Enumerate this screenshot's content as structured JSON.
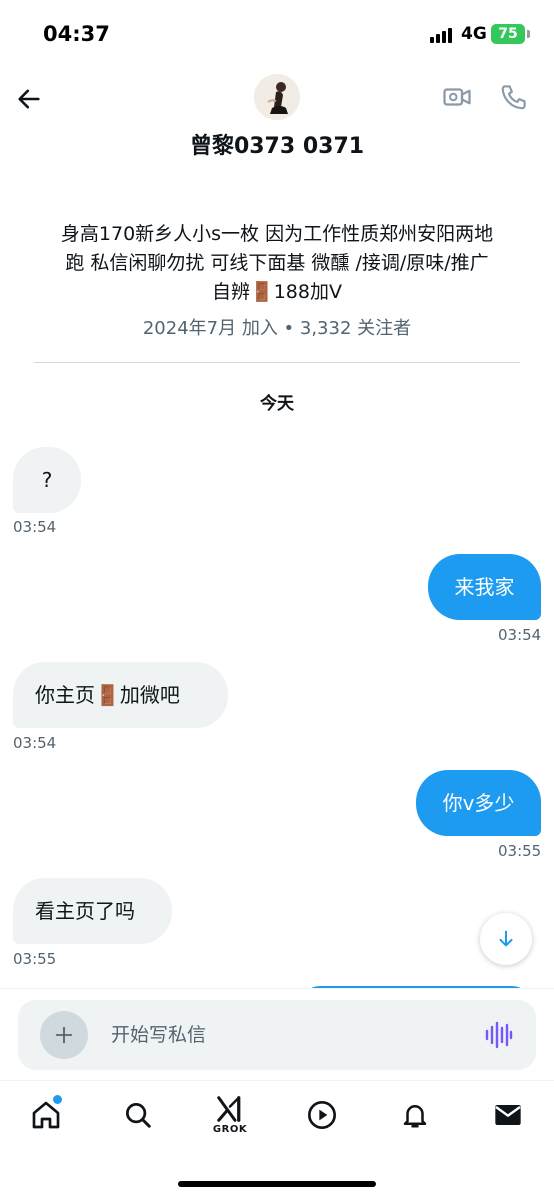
{
  "status_bar": {
    "time": "04:37",
    "network": "4G",
    "battery": "75"
  },
  "header": {
    "contact_name": "曾黎0373 0371"
  },
  "profile": {
    "bio_line1": "身高170新乡人小s一枚 因为工作性质郑州安阳两地",
    "bio_line2": "跑 私信闲聊勿扰 可线下面基 微醺 /接调/原味/推广",
    "bio_line3_prefix": "自辨",
    "bio_line3_emoji": "🚪",
    "bio_line3_suffix": "188加V",
    "joined": "2024年7月 加入 • 3,332 关注者"
  },
  "conversation": {
    "day_label": "今天",
    "messages": [
      {
        "direction": "in",
        "text": "?",
        "time": "03:54"
      },
      {
        "direction": "out",
        "text": "来我家",
        "time": "03:54"
      },
      {
        "direction": "in",
        "text_prefix": "你主页",
        "emoji": "🚪",
        "text_suffix": "加微吧",
        "time": "03:54"
      },
      {
        "direction": "out",
        "text": "你v多少",
        "time": "03:55"
      },
      {
        "direction": "in",
        "text": "看主页了吗",
        "time": "03:55"
      }
    ]
  },
  "composer": {
    "placeholder": "开始写私信"
  },
  "tabs": {
    "grok_label": "GROK"
  },
  "colors": {
    "accent": "#1d9bf0",
    "incoming_bubble": "#eff3f4",
    "battery": "#34c759",
    "voice_icon": "#7856ff"
  },
  "icons": {
    "back": "arrow-left-icon",
    "video": "video-camera-icon",
    "phone": "phone-icon",
    "scroll_down": "arrow-down-icon",
    "add": "plus-icon",
    "voice": "voice-wave-icon",
    "home": "home-icon",
    "search": "search-icon",
    "grok": "grok-icon",
    "video_tab": "play-circle-icon",
    "notifications": "bell-icon",
    "messages": "envelope-icon"
  }
}
